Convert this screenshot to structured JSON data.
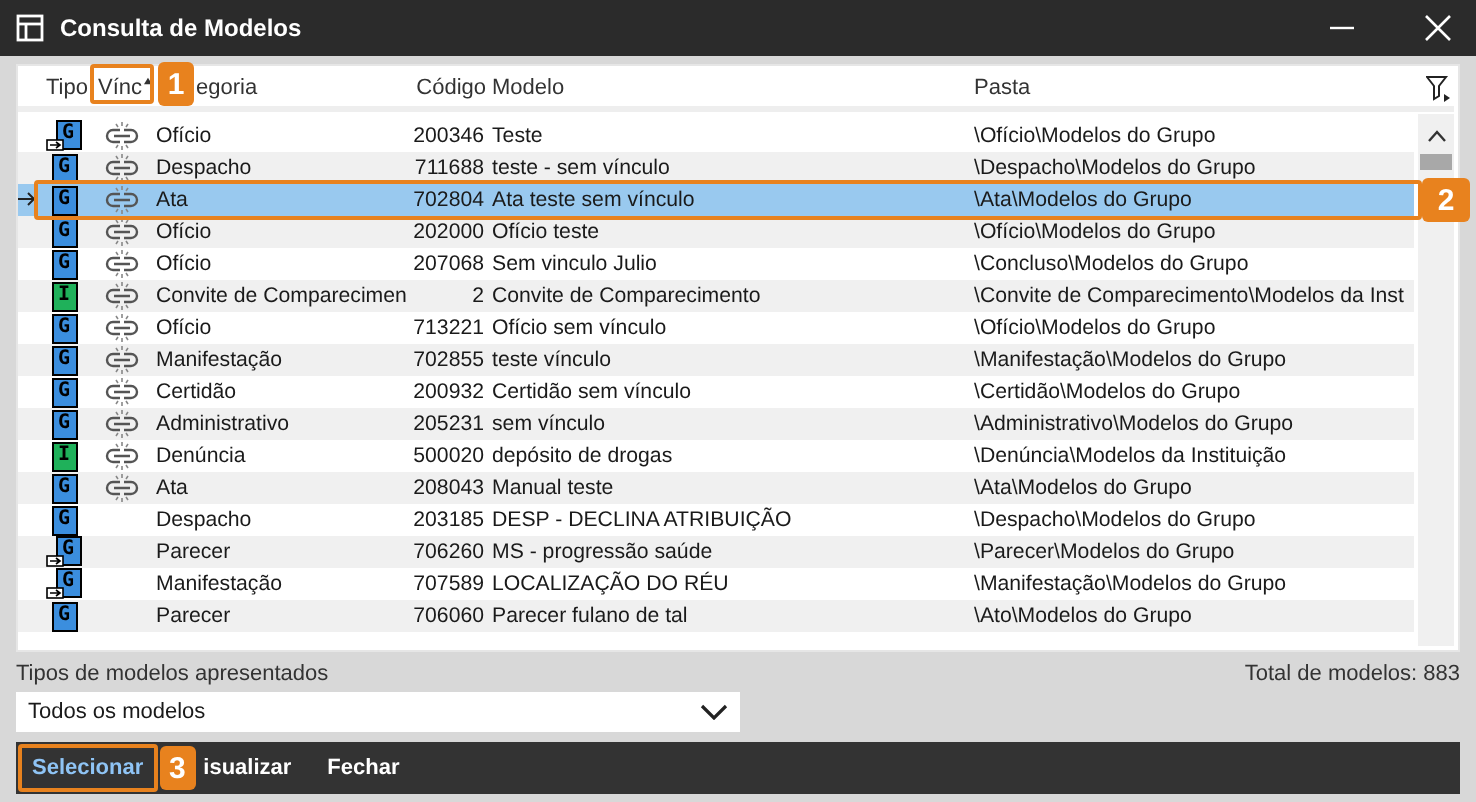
{
  "window": {
    "title": "Consulta de Modelos"
  },
  "table": {
    "columns": [
      {
        "label": "Tipo"
      },
      {
        "label": "Vínc",
        "sorted": true,
        "callout": "1"
      },
      {
        "label": "egoria"
      },
      {
        "label": "Código"
      },
      {
        "label": "Modelo"
      },
      {
        "label": "Pasta"
      }
    ],
    "rows": [
      {
        "type_letter": "G",
        "color": "#3b8ede",
        "shortcut": true,
        "linked": true,
        "category": "Ofício",
        "code": "200346",
        "model": "Teste",
        "folder": "\\Ofício\\Modelos do Grupo",
        "selected": false
      },
      {
        "type_letter": "G",
        "color": "#3b8ede",
        "shortcut": false,
        "linked": true,
        "category": "Despacho",
        "code": "711688",
        "model": "teste - sem vínculo",
        "folder": "\\Despacho\\Modelos do Grupo",
        "selected": false
      },
      {
        "type_letter": "G",
        "color": "#3b8ede",
        "shortcut": false,
        "linked": true,
        "category": "Ata",
        "code": "702804",
        "model": "Ata teste sem vínculo",
        "folder": "\\Ata\\Modelos do Grupo",
        "selected": true,
        "callout": "2"
      },
      {
        "type_letter": "G",
        "color": "#3b8ede",
        "shortcut": false,
        "linked": true,
        "category": "Ofício",
        "code": "202000",
        "model": "Ofício teste",
        "folder": "\\Ofício\\Modelos do Grupo",
        "selected": false
      },
      {
        "type_letter": "G",
        "color": "#3b8ede",
        "shortcut": false,
        "linked": true,
        "category": "Ofício",
        "code": "207068",
        "model": "Sem vinculo Julio",
        "folder": "\\Concluso\\Modelos do Grupo",
        "selected": false
      },
      {
        "type_letter": "I",
        "color": "#1fb15a",
        "shortcut": false,
        "linked": true,
        "category": "Convite de Comparecimen",
        "code": "2",
        "model": "Convite de Comparecimento",
        "folder": "\\Convite de Comparecimento\\Modelos da Inst",
        "selected": false
      },
      {
        "type_letter": "G",
        "color": "#3b8ede",
        "shortcut": false,
        "linked": true,
        "category": "Ofício",
        "code": "713221",
        "model": "Ofício sem vínculo",
        "folder": "\\Ofício\\Modelos do Grupo",
        "selected": false
      },
      {
        "type_letter": "G",
        "color": "#3b8ede",
        "shortcut": false,
        "linked": true,
        "category": "Manifestação",
        "code": "702855",
        "model": "teste vínculo",
        "folder": "\\Manifestação\\Modelos do Grupo",
        "selected": false
      },
      {
        "type_letter": "G",
        "color": "#3b8ede",
        "shortcut": false,
        "linked": true,
        "category": "Certidão",
        "code": "200932",
        "model": "Certidão sem vínculo",
        "folder": "\\Certidão\\Modelos do Grupo",
        "selected": false
      },
      {
        "type_letter": "G",
        "color": "#3b8ede",
        "shortcut": false,
        "linked": true,
        "category": "Administrativo",
        "code": "205231",
        "model": "sem vínculo",
        "folder": "\\Administrativo\\Modelos do Grupo",
        "selected": false
      },
      {
        "type_letter": "I",
        "color": "#1fb15a",
        "shortcut": false,
        "linked": true,
        "category": "Denúncia",
        "code": "500020",
        "model": "depósito de drogas",
        "folder": "\\Denúncia\\Modelos da Instituição",
        "selected": false
      },
      {
        "type_letter": "G",
        "color": "#3b8ede",
        "shortcut": false,
        "linked": true,
        "category": "Ata",
        "code": "208043",
        "model": "Manual teste",
        "folder": "\\Ata\\Modelos do Grupo",
        "selected": false
      },
      {
        "type_letter": "G",
        "color": "#3b8ede",
        "shortcut": false,
        "linked": false,
        "category": "Despacho",
        "code": "203185",
        "model": "DESP - DECLINA ATRIBUIÇÃO",
        "folder": "\\Despacho\\Modelos do Grupo",
        "selected": false
      },
      {
        "type_letter": "G",
        "color": "#3b8ede",
        "shortcut": true,
        "linked": false,
        "category": "Parecer",
        "code": "706260",
        "model": "MS - progressão saúde",
        "folder": "\\Parecer\\Modelos do Grupo",
        "selected": false
      },
      {
        "type_letter": "G",
        "color": "#3b8ede",
        "shortcut": true,
        "linked": false,
        "category": "Manifestação",
        "code": "707589",
        "model": "LOCALIZAÇÃO DO RÉU",
        "folder": "\\Manifestação\\Modelos do Grupo",
        "selected": false
      },
      {
        "type_letter": "G",
        "color": "#3b8ede",
        "shortcut": false,
        "linked": false,
        "category": "Parecer",
        "code": "706060",
        "model": "Parecer fulano de tal",
        "folder": "\\Ato\\Modelos do Grupo",
        "selected": false
      }
    ]
  },
  "filter": {
    "label": "Tipos de modelos apresentados",
    "value": "Todos os modelos"
  },
  "total": "Total de modelos: 883",
  "buttons": [
    {
      "label": "Selecionar",
      "selected": true,
      "callout": "3"
    },
    {
      "label": "isualizar",
      "selected": false
    },
    {
      "label": "Fechar",
      "selected": false
    }
  ]
}
